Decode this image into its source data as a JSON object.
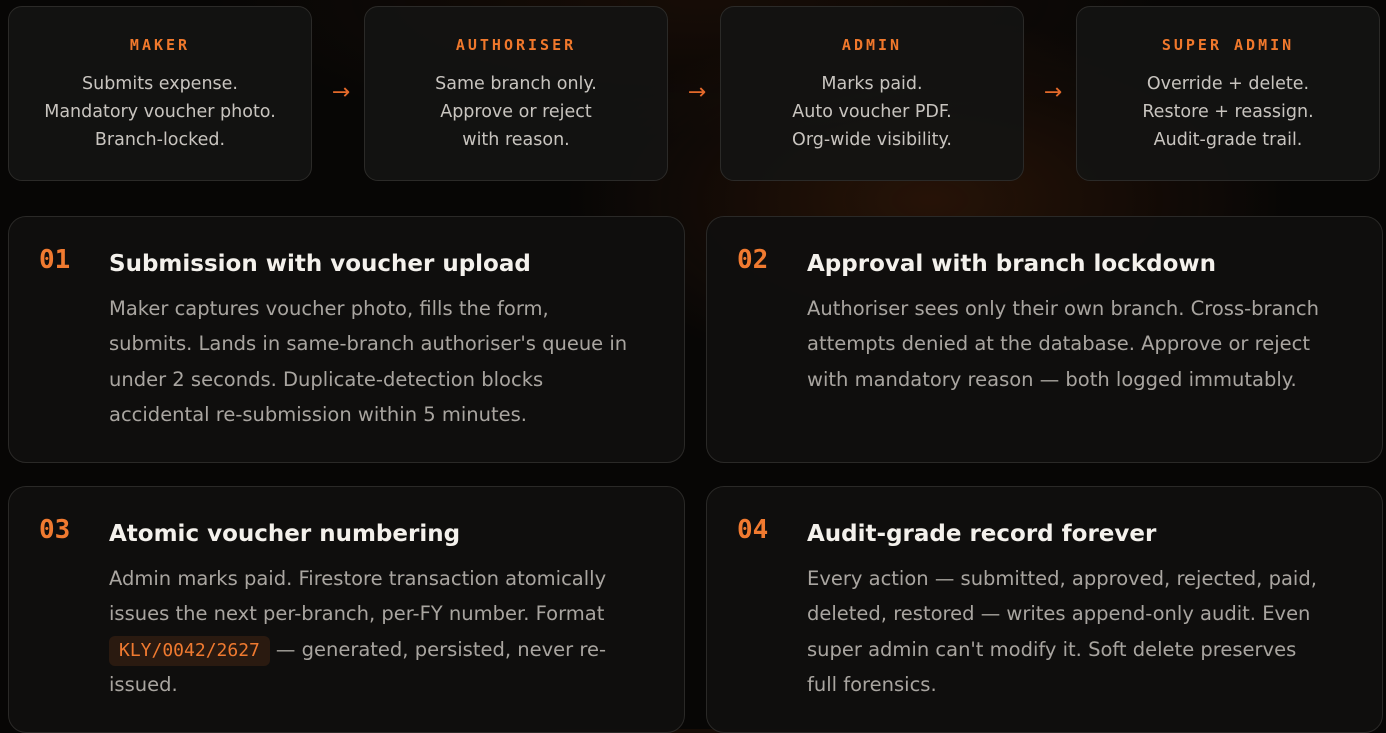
{
  "roles": [
    {
      "title": "MAKER",
      "lines": [
        "Submits expense.",
        "Mandatory voucher photo.",
        "Branch-locked."
      ]
    },
    {
      "title": "AUTHORISER",
      "lines": [
        "Same branch only.",
        "Approve or reject",
        "with reason."
      ]
    },
    {
      "title": "ADMIN",
      "lines": [
        "Marks paid.",
        "Auto voucher PDF.",
        "Org-wide visibility."
      ]
    },
    {
      "title": "SUPER ADMIN",
      "lines": [
        "Override + delete.",
        "Restore + reassign.",
        "Audit-grade trail."
      ]
    }
  ],
  "arrow_glyph": "→",
  "features": [
    {
      "number": "01",
      "title": "Submission with voucher upload",
      "lines": [
        "Maker captures voucher photo, fills the form,",
        "submits. Lands in same-branch authoriser's queue in",
        "under 2 seconds. Duplicate-detection blocks",
        "accidental re-submission within 5 minutes."
      ]
    },
    {
      "number": "02",
      "title": "Approval with branch lockdown",
      "lines": [
        "Authoriser sees only their own branch. Cross-branch",
        "attempts denied at the database. Approve or reject",
        "with mandatory reason — both logged immutably."
      ]
    },
    {
      "number": "03",
      "title": "Atomic voucher numbering",
      "lines": [
        "Admin marks paid. Firestore transaction atomically",
        "issues the next per-branch, per-FY number. Format"
      ],
      "code": "KLY/0042/2627",
      "code_suffix": "— generated, persisted, never re-",
      "tail": "issued."
    },
    {
      "number": "04",
      "title": "Audit-grade record forever",
      "lines": [
        "Every action — submitted, approved, rejected, paid,",
        "deleted, restored — writes append-only audit. Even",
        "super admin can't modify it. Soft delete preserves",
        "full forensics."
      ]
    }
  ],
  "colors": {
    "accent": "#f07a30",
    "background": "#070605",
    "card": "#100f0e",
    "text_primary": "#f4f1ec",
    "text_secondary": "#a9a5a0"
  }
}
